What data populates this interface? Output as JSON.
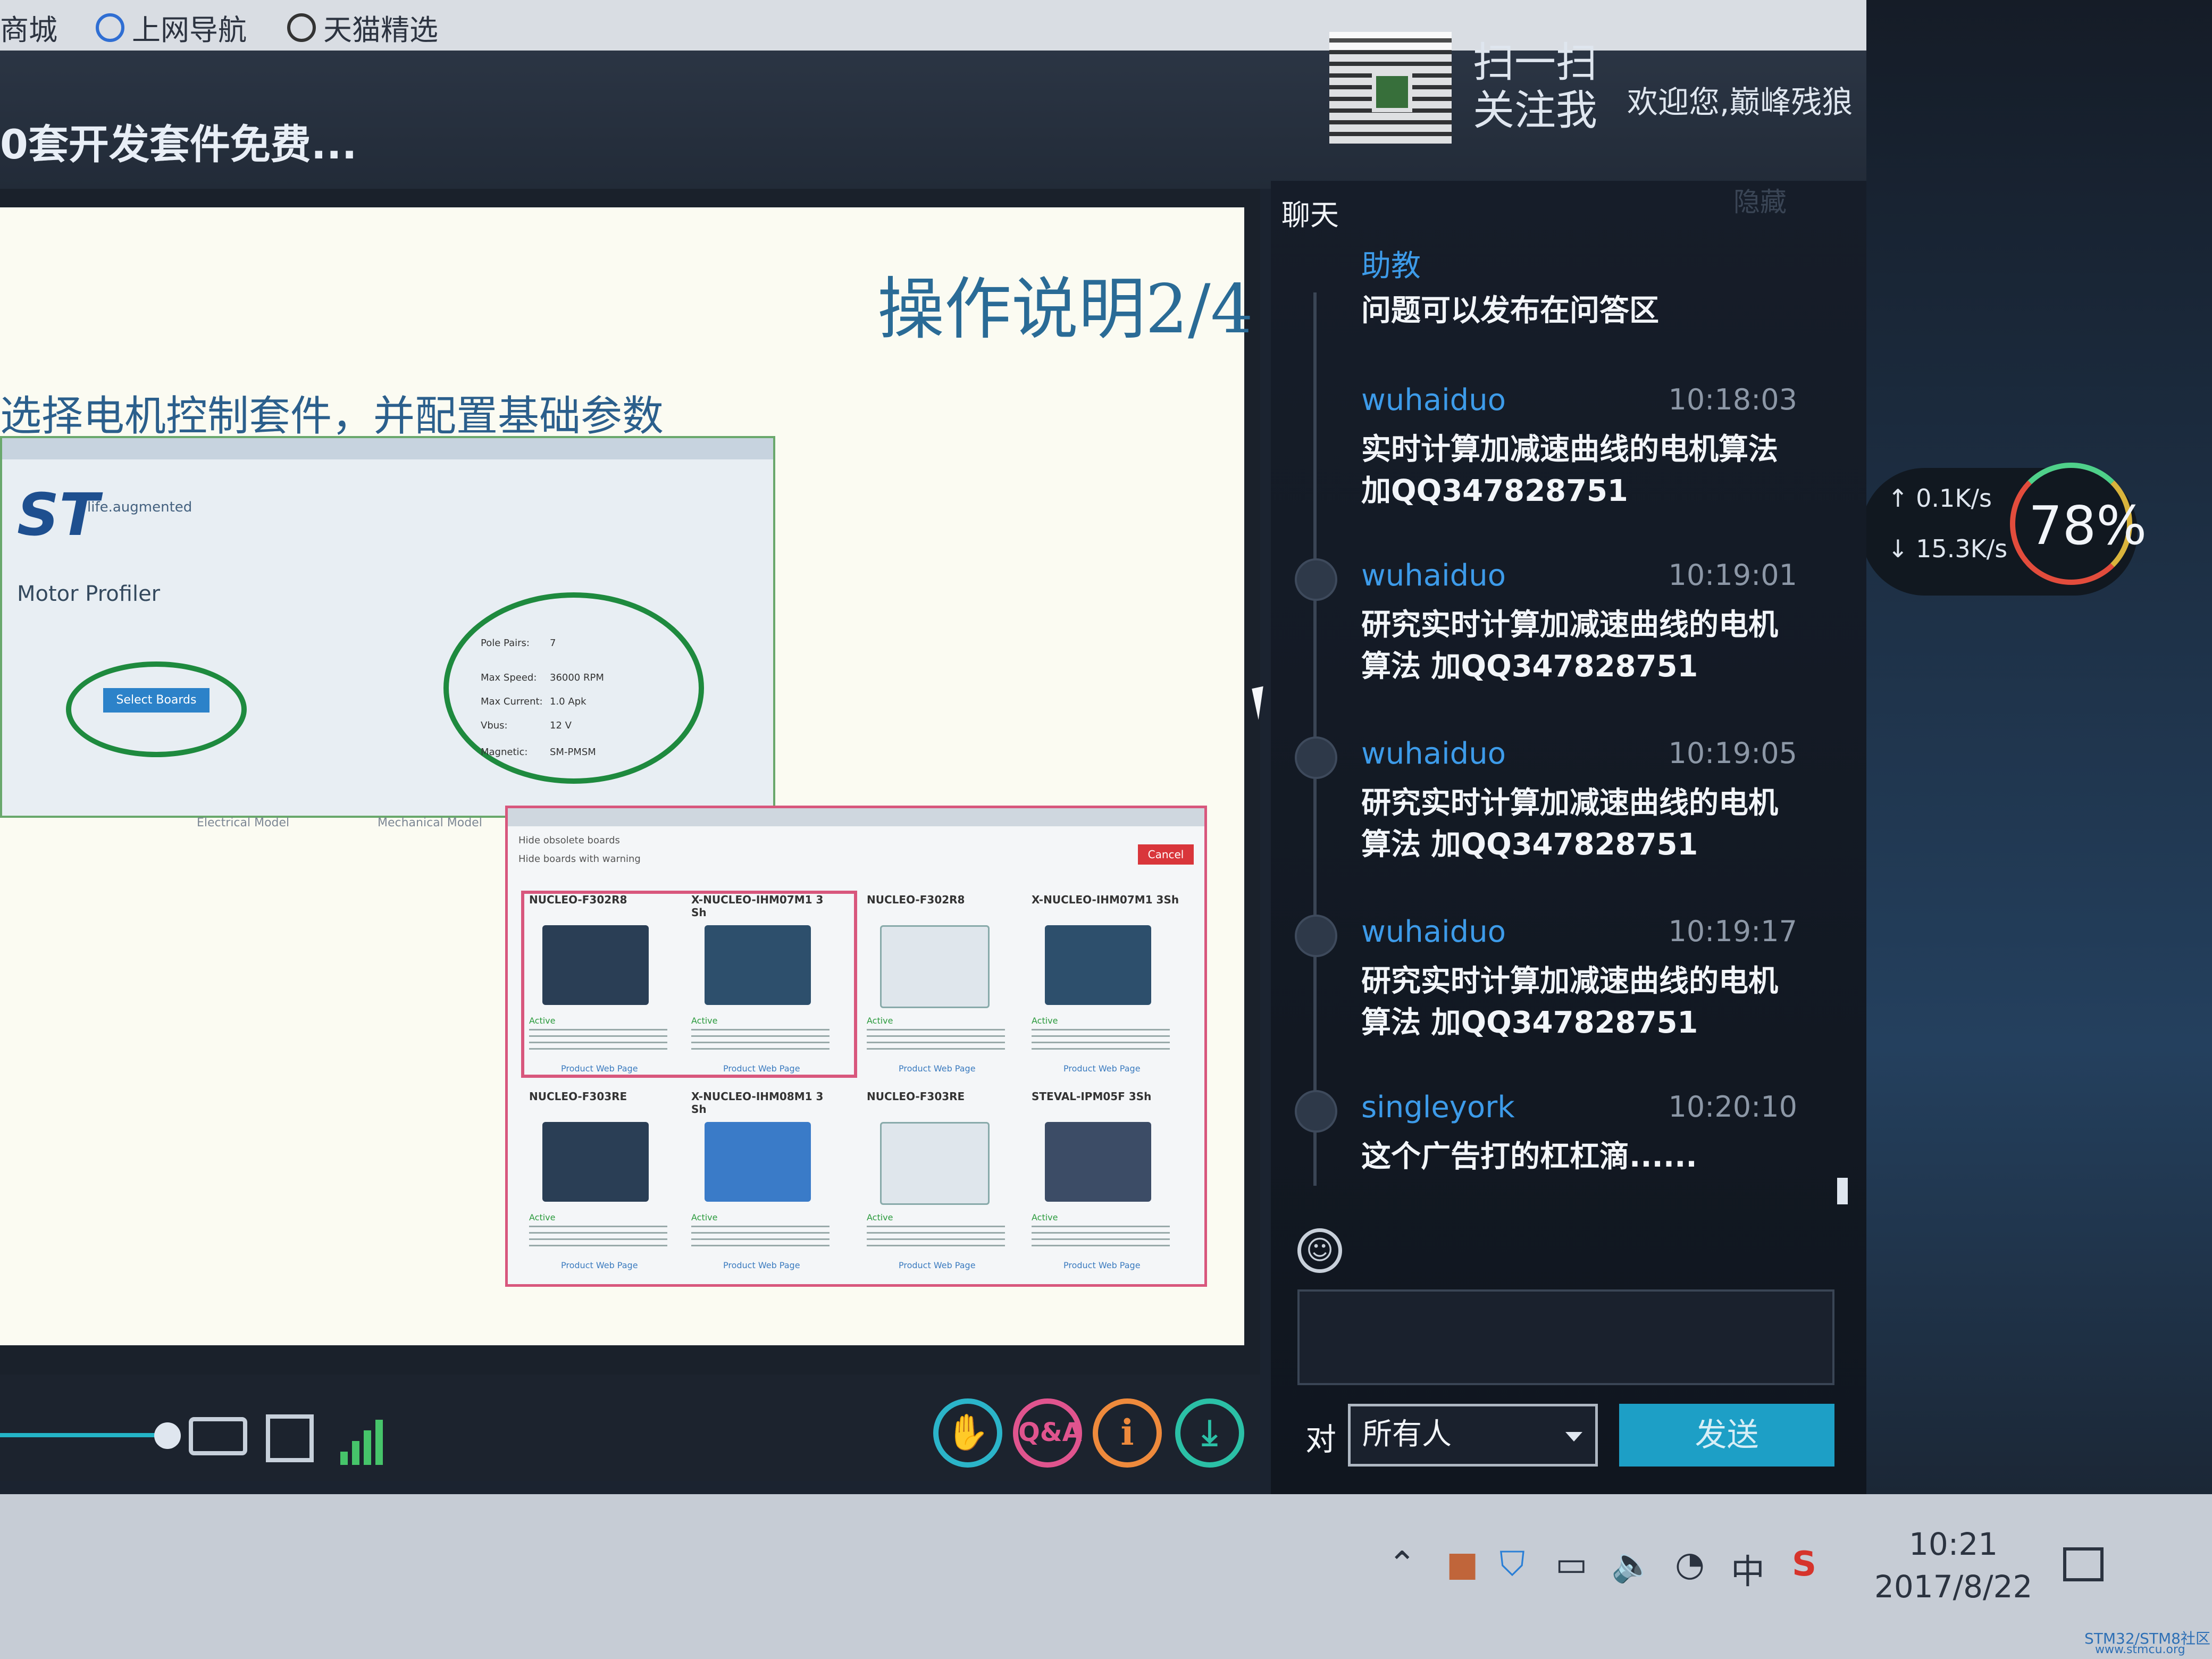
{
  "bookmarks": [
    "商城",
    "上网导航",
    "天猫精选"
  ],
  "course_title": "0套开发套件免费...",
  "header": {
    "scan_text": "扫一扫",
    "follow_text": "关注我",
    "welcome_text": "欢迎您,巅峰残狼"
  },
  "slide": {
    "title": "操作说明2/4",
    "subtitle": "选择电机控制套件，并配置基础参数",
    "shot1": {
      "logo": "ST",
      "tagline": "life.augmented",
      "app_label": "Motor Profiler",
      "select_button": "Select Boards",
      "params": [
        "Pole Pairs:",
        "Max Speed:",
        "Max Current:",
        "Vbus:",
        "Magnetic:"
      ],
      "param_values": [
        "7",
        "36000 RPM",
        "1.0 Apk",
        "12 V",
        "SM-PMSM"
      ],
      "models": [
        "Electrical Model",
        "Mechanical Model"
      ]
    },
    "shot2": {
      "cancel_label": "Cancel",
      "checks": [
        "Hide obsolete boards",
        "Hide boards with warning"
      ],
      "cards": [
        {
          "name": "NUCLEO-F302R8",
          "active": "Active",
          "link": "Product Web Page"
        },
        {
          "name": "X-NUCLEO-IHM07M1 3 Sh",
          "active": "Active",
          "link": "Product Web Page"
        },
        {
          "name": "NUCLEO-F302R8",
          "active": "Active",
          "link": "Product Web Page"
        },
        {
          "name": "X-NUCLEO-IHM07M1 3Sh",
          "active": "Active",
          "link": "Product Web Page"
        },
        {
          "name": "NUCLEO-F303RE",
          "active": "Active",
          "link": "Product Web Page"
        },
        {
          "name": "X-NUCLEO-IHM08M1 3 Sh",
          "active": "Active",
          "link": "Product Web Page"
        },
        {
          "name": "NUCLEO-F303RE",
          "active": "Active",
          "link": "Product Web Page"
        },
        {
          "name": "STEVAL-IPM05F 3Sh",
          "active": "Active",
          "link": "Product Web Page"
        }
      ]
    }
  },
  "controls": {
    "hand_label": "✋",
    "qa_label": "Q&A",
    "info_label": "i",
    "download_label": "⤓"
  },
  "chat": {
    "title": "聊天",
    "hide_label": "隐藏",
    "messages": [
      {
        "user": "助教",
        "time": "",
        "text": "问题可以发布在问答区"
      },
      {
        "user": "wuhaiduo",
        "time": "10:18:03",
        "text": "实时计算加减速曲线的电机算法 加QQ347828751"
      },
      {
        "user": "wuhaiduo",
        "time": "10:19:01",
        "text": "研究实时计算加减速曲线的电机算法 加QQ347828751"
      },
      {
        "user": "wuhaiduo",
        "time": "10:19:05",
        "text": "研究实时计算加减速曲线的电机算法 加QQ347828751"
      },
      {
        "user": "wuhaiduo",
        "time": "10:19:17",
        "text": "研究实时计算加减速曲线的电机算法 加QQ347828751"
      },
      {
        "user": "singleyork",
        "time": "10:20:10",
        "text": "这个广告打的杠杠滴......"
      }
    ],
    "to_label": "对",
    "recipient": "所有人",
    "send_label": "发送"
  },
  "net": {
    "up": "↑ 0.1K/s",
    "down": "↓ 15.3K/s",
    "cpu": "78%"
  },
  "taskbar": {
    "ime": "中",
    "time": "10:21",
    "date": "2017/8/22"
  },
  "watermark": {
    "line1": "STM32/STM8社区",
    "line2": "www.stmcu.org"
  },
  "colors": {
    "accent": "#1d9fc6",
    "username": "#3d9be9",
    "slide_title": "#2a6b96"
  }
}
